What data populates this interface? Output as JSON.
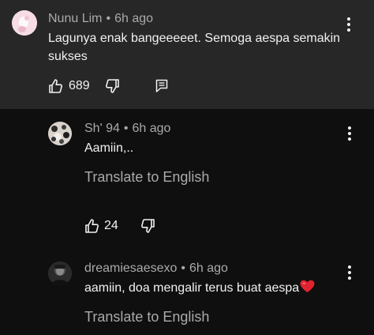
{
  "comment": {
    "author": "Nunu Lim",
    "time": "6h ago",
    "text_line1": "Lagunya enak bangeeeeet. Semoga aespa semakin",
    "text_line2": "sukses",
    "likes": "689",
    "icons": [
      "thumb-up-icon",
      "thumb-down-icon",
      "reply-icon",
      "more-vert-icon"
    ]
  },
  "replies": [
    {
      "author": "Sh' 94",
      "time": "6h ago",
      "text": "Aamiin,..",
      "translate": "Translate to English",
      "likes": "24"
    },
    {
      "author": "dreamiesaesexo",
      "time": "6h ago",
      "text": "aamiin, doa mengalir terus buat aespa",
      "emoji": "red-heart-emoji",
      "translate": "Translate to English"
    }
  ],
  "separator": "•",
  "colors": {
    "top_background": "#272727",
    "page_background": "#0f0f0f",
    "primary_text": "#f1f1f1",
    "secondary_text": "#aaaaaa",
    "heart": "#e0242f"
  }
}
